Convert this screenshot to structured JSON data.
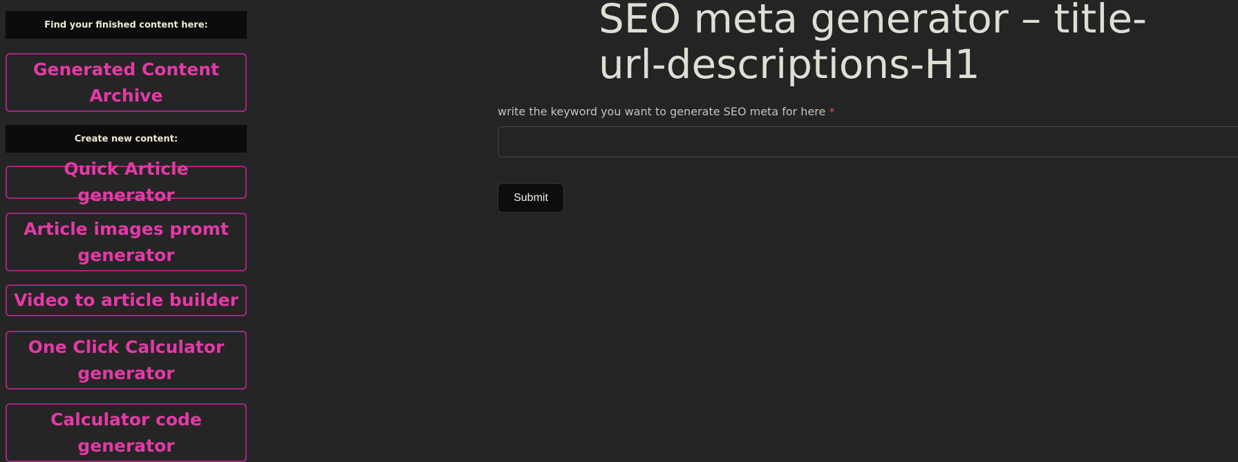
{
  "sidebar": {
    "section_finished": "Find your finished content here:",
    "archive_label": "Generated Content Archive",
    "section_create": "Create new content:",
    "items": [
      {
        "label": "Quick Article generator"
      },
      {
        "label": "Article images promt generator"
      },
      {
        "label": "Video to article builder"
      },
      {
        "label": "One Click Calculator generator"
      },
      {
        "label": "Calculator code generator"
      }
    ]
  },
  "main": {
    "title": "SEO meta generator – title-url-descriptions-H1",
    "field_label": "write the keyword you want to generate SEO meta for here",
    "required_mark": "*",
    "keyword_value": "",
    "submit_label": "Submit"
  }
}
